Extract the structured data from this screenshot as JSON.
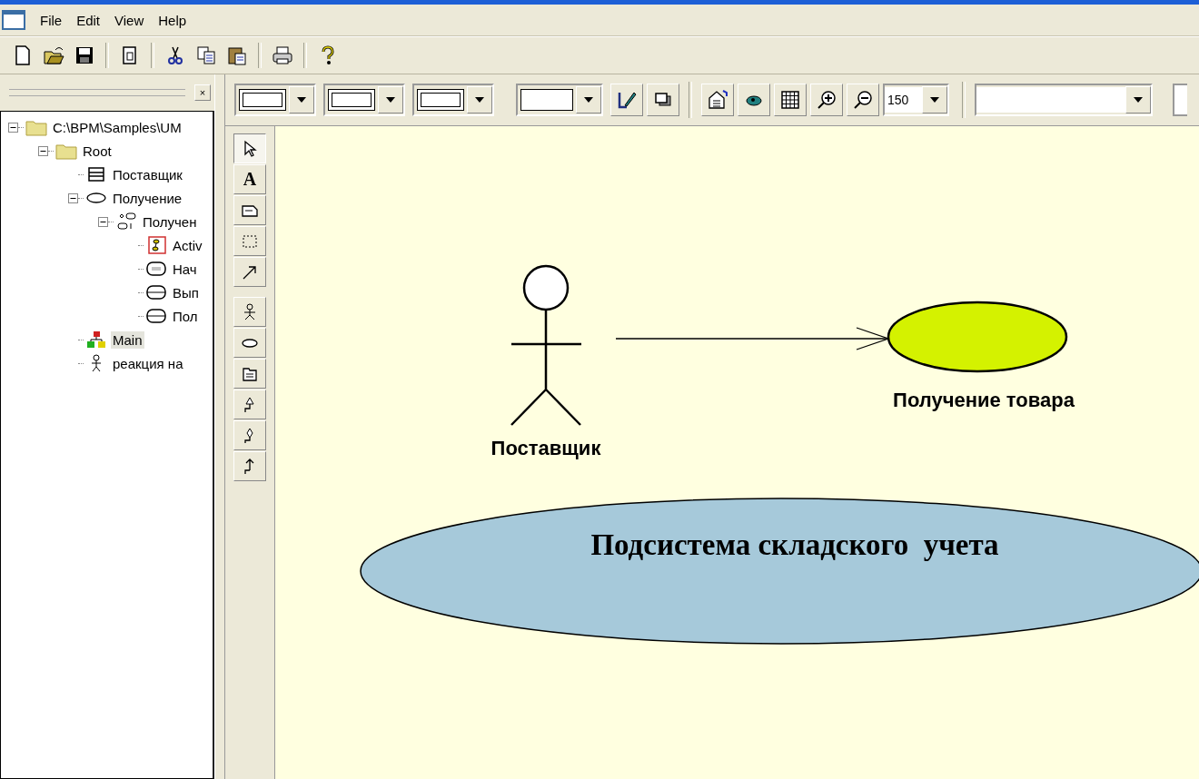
{
  "menu": [
    "File",
    "Edit",
    "View",
    "Help"
  ],
  "toolbar": [
    {
      "kind": "new"
    },
    {
      "kind": "open"
    },
    {
      "kind": "save"
    },
    {
      "kind": "sep"
    },
    {
      "kind": "copy-doc"
    },
    {
      "kind": "sep"
    },
    {
      "kind": "cut"
    },
    {
      "kind": "copy"
    },
    {
      "kind": "paste"
    },
    {
      "kind": "sep"
    },
    {
      "kind": "print"
    },
    {
      "kind": "sep"
    },
    {
      "kind": "help"
    }
  ],
  "panel": {
    "close_glyph": "×"
  },
  "tree": [
    {
      "label": "C:\\BPM\\Samples\\UM",
      "kind": "folder",
      "expanded": true,
      "selected": false,
      "children": [
        {
          "label": "Root",
          "kind": "folder",
          "expanded": true,
          "selected": false,
          "children": [
            {
              "label": "Поставщик",
              "kind": "class",
              "selected": false
            },
            {
              "label": "Получение",
              "kind": "usecase",
              "expanded": true,
              "selected": false,
              "children": [
                {
                  "label": "Получен",
                  "kind": "activity-diagram",
                  "expanded": true,
                  "selected": false,
                  "children": [
                    {
                      "label": "Activ",
                      "kind": "activity",
                      "selected": false
                    },
                    {
                      "label": "Нач",
                      "kind": "state",
                      "selected": false
                    },
                    {
                      "label": "Вып",
                      "kind": "action",
                      "selected": false
                    },
                    {
                      "label": "Пол",
                      "kind": "action",
                      "selected": false
                    }
                  ]
                }
              ]
            },
            {
              "label": "Main",
              "kind": "diagram",
              "selected": true
            },
            {
              "label": "реакция на",
              "kind": "actor",
              "selected": false
            }
          ]
        }
      ]
    }
  ],
  "diagram_toolbar": [
    {
      "kind": "style-combo"
    },
    {
      "kind": "style-combo"
    },
    {
      "kind": "style-combo"
    },
    {
      "kind": "color-combo"
    },
    {
      "kind": "pen"
    },
    {
      "kind": "shadow"
    },
    {
      "kind": "sep"
    },
    {
      "kind": "properties"
    },
    {
      "kind": "view"
    },
    {
      "kind": "grid"
    },
    {
      "kind": "zoom-in"
    },
    {
      "kind": "zoom-out"
    },
    {
      "kind": "zoom-combo",
      "value": "150"
    },
    {
      "kind": "sep"
    },
    {
      "kind": "font-combo"
    },
    {
      "kind": "partial-combo"
    }
  ],
  "palette": [
    {
      "kind": "pointer",
      "selected": true
    },
    {
      "kind": "text",
      "label": "A",
      "selected": false
    },
    {
      "kind": "note",
      "selected": false
    },
    {
      "kind": "boundary",
      "selected": false
    },
    {
      "kind": "arrow",
      "selected": false
    },
    {
      "kind": "gap"
    },
    {
      "kind": "actor",
      "selected": false
    },
    {
      "kind": "usecase",
      "selected": false
    },
    {
      "kind": "package",
      "selected": false
    },
    {
      "kind": "generalization",
      "selected": false
    },
    {
      "kind": "diamond-link",
      "selected": false
    },
    {
      "kind": "dependency",
      "selected": false
    }
  ],
  "diagram": {
    "actor": {
      "label": "Поставщик"
    },
    "use_case": {
      "label": "Получение товара"
    },
    "association": {
      "directed": true
    },
    "system": {
      "label": "Подсистема складского  учета"
    }
  }
}
